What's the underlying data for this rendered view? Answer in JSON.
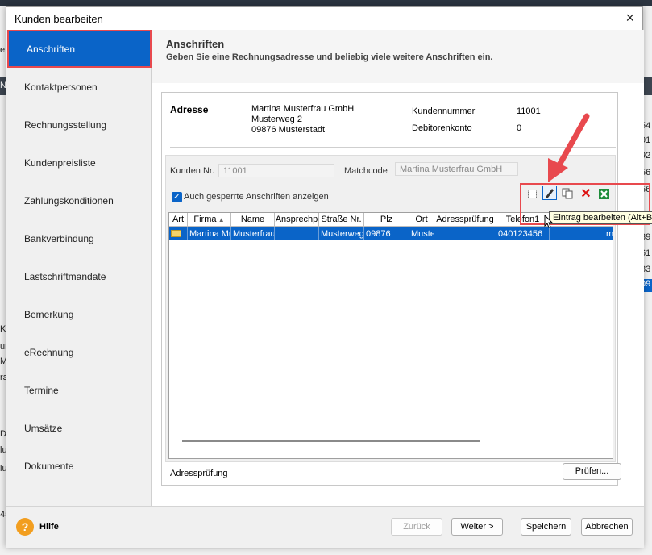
{
  "window": {
    "title": "Kunden bearbeiten",
    "close_glyph": "×"
  },
  "nav": {
    "items": [
      {
        "label": "Anschriften",
        "active": true
      },
      {
        "label": "Kontaktpersonen"
      },
      {
        "label": "Rechnungsstellung"
      },
      {
        "label": "Kundenpreisliste"
      },
      {
        "label": "Zahlungskonditionen"
      },
      {
        "label": "Bankverbindung"
      },
      {
        "label": "Lastschriftmandate"
      },
      {
        "label": "Bemerkung"
      },
      {
        "label": "eRechnung"
      },
      {
        "label": "Termine"
      },
      {
        "label": "Umsätze"
      },
      {
        "label": "Dokumente"
      }
    ]
  },
  "section": {
    "title": "Anschriften",
    "subtitle": "Geben Sie eine Rechnungsadresse und beliebig viele weitere Anschriften ein."
  },
  "address": {
    "label": "Adresse",
    "lines": [
      "Martina Musterfrau GmbH",
      "Musterweg 2",
      "09876 Musterstadt"
    ],
    "kundennummer_label": "Kundennummer",
    "kundennummer_value": "11001",
    "debitorenkonto_label": "Debitorenkonto",
    "debitorenkonto_value": "0"
  },
  "filters": {
    "kunden_nr_label": "Kunden Nr.",
    "kunden_nr_value": "11001",
    "matchcode_label": "Matchcode",
    "matchcode_value": "Martina Musterfrau GmbH",
    "checkbox_label": "Auch gesperrte  Anschriften anzeigen",
    "checkbox_checked": true
  },
  "toolbar": {
    "tooltip": "Eintrag bearbeiten (Alt+B)"
  },
  "grid": {
    "columns": [
      "Art",
      "Firma",
      "Name",
      "Ansprechp",
      "Straße Nr.",
      "Plz",
      "Ort",
      "Adressprüfung",
      "Telefon1"
    ],
    "rows": [
      [
        "",
        "Martina Mu",
        "Musterfrau",
        "",
        "Musterweg",
        "09876",
        "Muste",
        "",
        "040123456"
      ]
    ],
    "extra_cell": "m"
  },
  "footer": {
    "adresspruefung_label": "Adressprüfung",
    "pruefen_button": "Prüfen..."
  },
  "bottom": {
    "help_label": "Hilfe",
    "help_glyph": "?",
    "zurueck": "Zurück",
    "weiter": "Weiter >",
    "speichern": "Speichern",
    "abbrechen": "Abbrechen"
  },
  "background": {
    "right_numbers": [
      "54",
      "91",
      "92",
      "56",
      "56",
      "39",
      "61",
      "83",
      "09"
    ],
    "left_letters": [
      "e",
      "N",
      "K",
      "ur",
      "M",
      "ra",
      "De",
      "lu",
      "lu",
      "45"
    ]
  },
  "colors": {
    "accent": "#0a64c8",
    "highlight_red": "#e8494e",
    "arrow_red": "#e8494e",
    "help_orange": "#f29e1f"
  }
}
